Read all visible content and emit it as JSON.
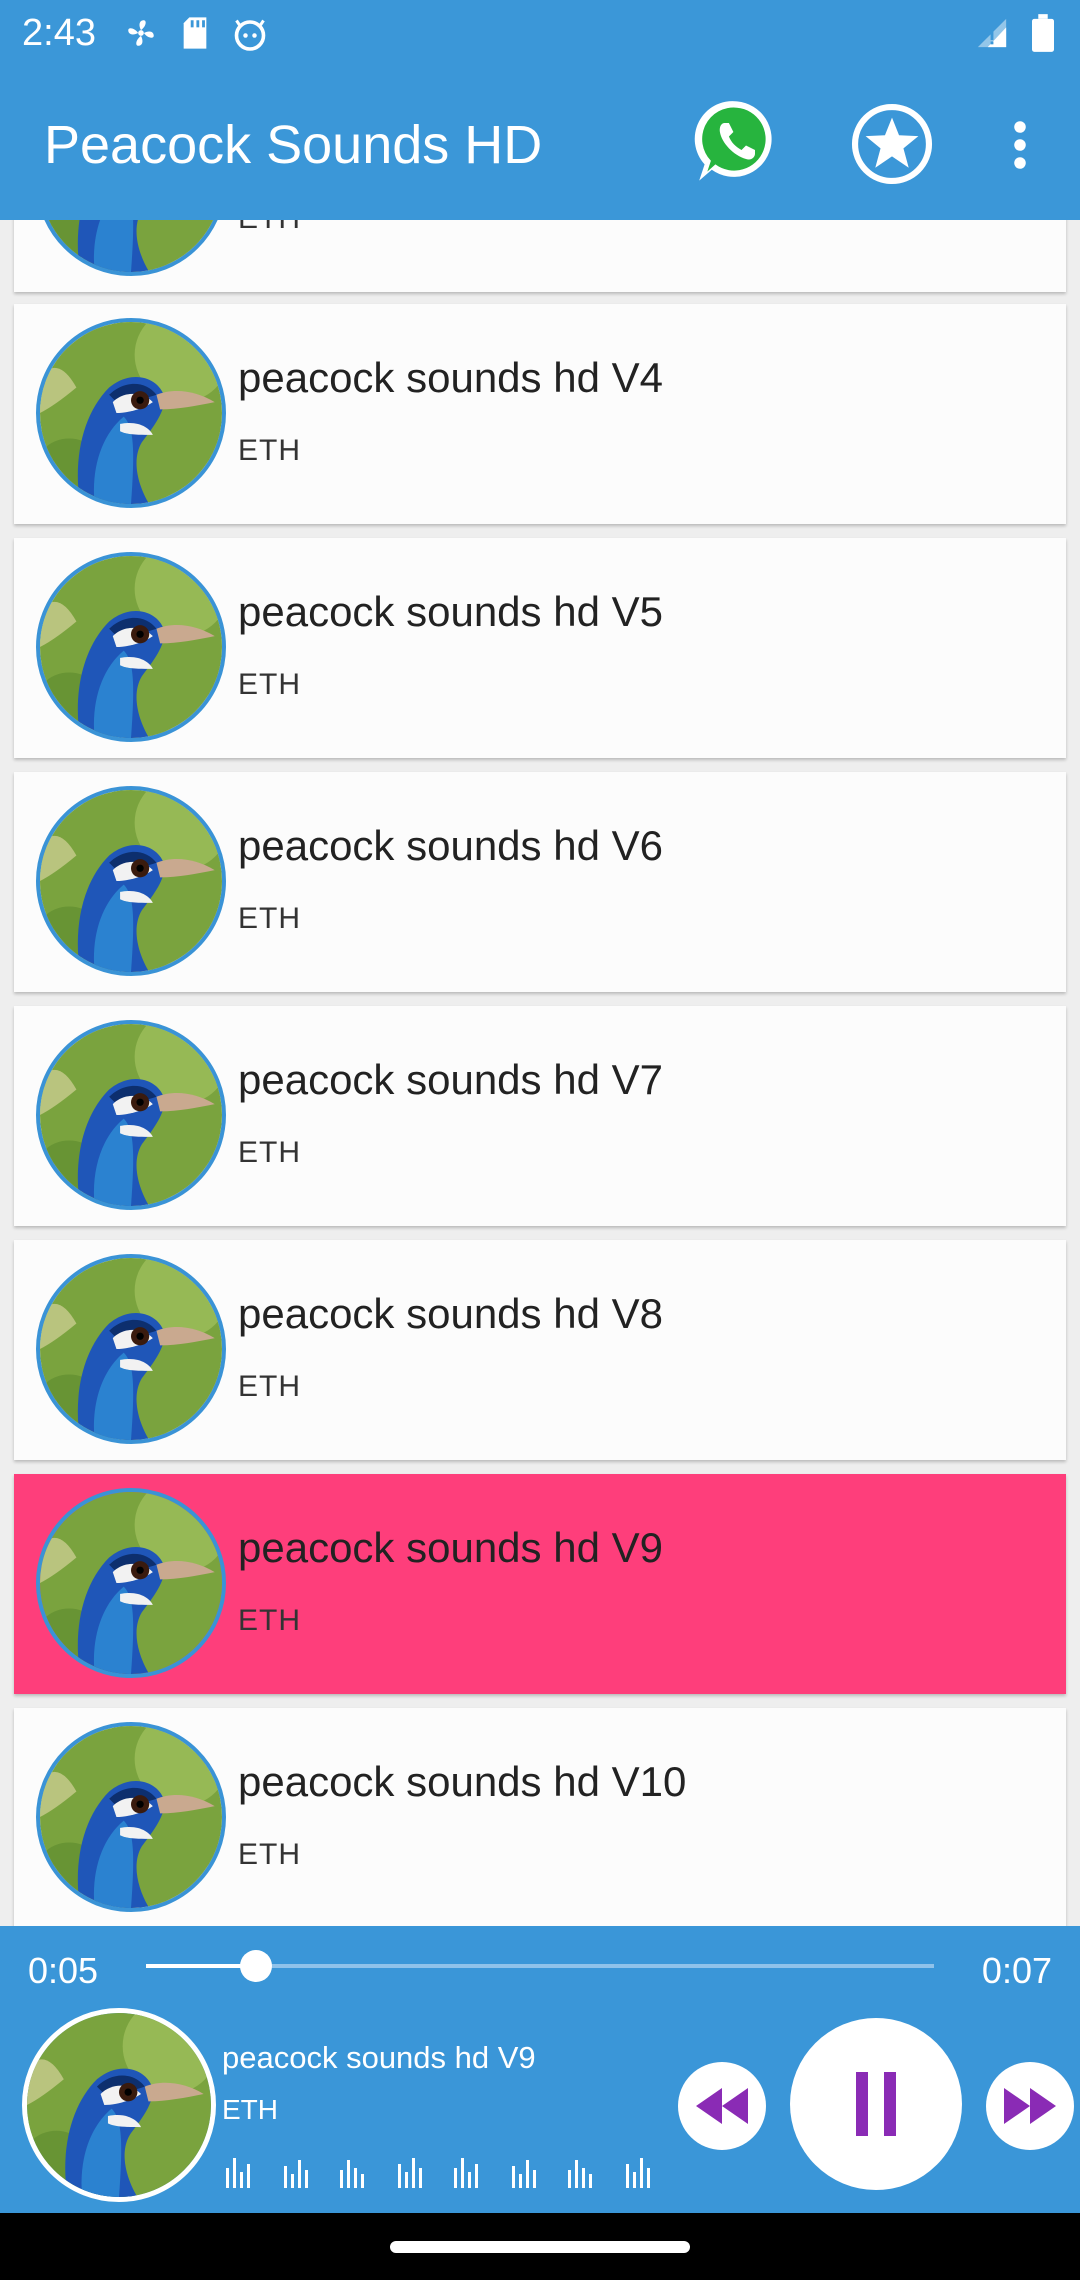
{
  "status_bar": {
    "time": "2:43",
    "left_icons": [
      "fan-icon",
      "sd-card-icon",
      "android-face-icon"
    ],
    "right_icons": [
      "signal-icon",
      "battery-icon"
    ]
  },
  "app_bar": {
    "title": "Peacock Sounds HD",
    "actions": [
      "whatsapp-icon",
      "star-icon",
      "more-vert-icon"
    ]
  },
  "tracks": [
    {
      "title": "",
      "artist": "ETH",
      "selected": false,
      "partial": true
    },
    {
      "title": "peacock sounds hd V4",
      "artist": "ETH",
      "selected": false
    },
    {
      "title": "peacock sounds hd V5",
      "artist": "ETH",
      "selected": false
    },
    {
      "title": "peacock sounds hd V6",
      "artist": "ETH",
      "selected": false
    },
    {
      "title": "peacock sounds hd V7",
      "artist": "ETH",
      "selected": false
    },
    {
      "title": "peacock sounds hd V8",
      "artist": "ETH",
      "selected": false
    },
    {
      "title": "peacock sounds hd V9",
      "artist": "ETH",
      "selected": true
    },
    {
      "title": "peacock sounds hd V10",
      "artist": "ETH",
      "selected": false
    }
  ],
  "player": {
    "current_time": "0:05",
    "duration": "0:07",
    "progress": 0.14,
    "now_playing_title": "peacock sounds hd V9",
    "now_playing_artist": "ETH",
    "controls": [
      "rewind-icon",
      "pause-icon",
      "fast-forward-icon"
    ]
  },
  "colors": {
    "primary": "#3b97d8",
    "selected_row": "#fe3e7b",
    "control_icon": "#8a2bb5",
    "whatsapp_green": "#27b43e"
  }
}
